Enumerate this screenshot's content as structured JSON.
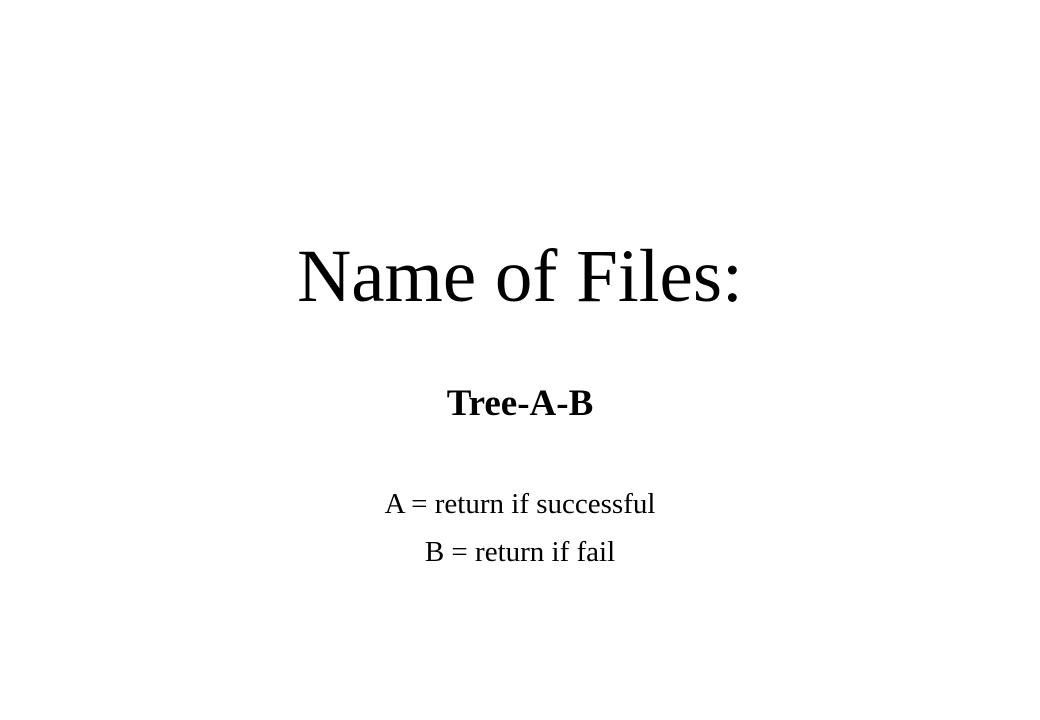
{
  "slide": {
    "title": "Name of Files:",
    "subtitle": "Tree-A-B",
    "definitions": [
      "A = return if successful",
      "B = return if fail"
    ]
  },
  "colors": {
    "background": "#ffffff",
    "text": "#000000"
  }
}
